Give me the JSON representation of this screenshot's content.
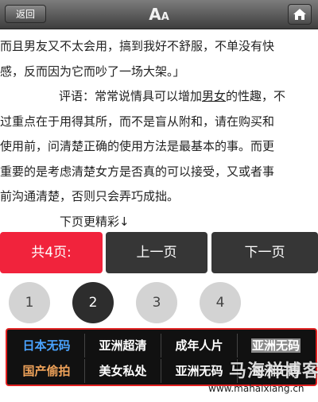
{
  "toolbar": {
    "back_label": "返回",
    "font_size_icon": "font-size-icon",
    "home_icon": "home-icon"
  },
  "article": {
    "lines": [
      "而且男友又不太会用，搞到我好不舒服，不单没有快",
      "感，反而因为它而吵了一场大架。」",
      "评语：常常说情具可以增加",
      "男女",
      "的性趣，不",
      "过重点在于用得其所，而不是盲从附和，请在购买和",
      "使用前，问清楚正确的使用方法是最基本的事。而更",
      "重要的是考虑清楚女方是否真的可以接受，又或者事",
      "前沟通清楚，否则只会弄巧成拙。",
      "下页更精彩↓"
    ]
  },
  "pager": {
    "total_label": "共4页:",
    "prev_label": "上一页",
    "next_label": "下一页",
    "pages": [
      "1",
      "2",
      "3",
      "4"
    ],
    "current_page": "2"
  },
  "links": {
    "row1": [
      "日本无码",
      "亚洲超清",
      "成年人片",
      "亚洲无码"
    ],
    "row2": [
      "国产偷拍",
      "美女私处",
      "亚洲无码",
      "亚洲无码"
    ]
  },
  "watermark": {
    "text": "马海祥博客",
    "url": "www.mahaixiang.cn"
  },
  "colors": {
    "topbar": "#4a4a4a",
    "accent_red": "#f1233c",
    "dark_button": "#363636",
    "link_blue": "#4aa3ff",
    "link_orange": "#f0a35a",
    "grid_border": "#e02020"
  }
}
